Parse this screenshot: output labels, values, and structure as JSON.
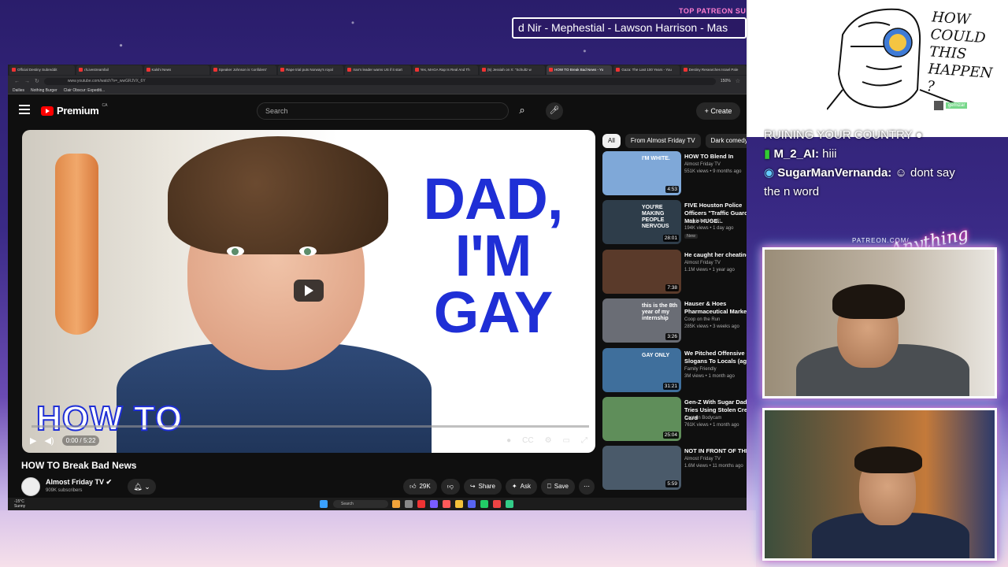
{
  "overlay": {
    "patreon_label": "TOP PATREON SUBS",
    "ticker_text": "d Nir - Mephestial - Lawson Harrison - Mas",
    "drawing_text": "HOW COULD THIS HAPPEN ?",
    "drawing_user": "gemizar",
    "patreon_url": "PATREON.COM/",
    "anything_else": "Anything Else",
    "chat": [
      {
        "user": "",
        "text": "RUINING YOUR COUNTRY"
      },
      {
        "user": "M_2_AI:",
        "text": "hiii"
      },
      {
        "user": "SugarManVernanda:",
        "text": "dont say"
      },
      {
        "user": "",
        "text": "the n word"
      }
    ]
  },
  "browser": {
    "tabs": [
      {
        "label": "Official Destiny Subreddit"
      },
      {
        "label": "r/Livestreamfail"
      },
      {
        "label": "Kalshi News"
      },
      {
        "label": "Speaker Johnson is 'confident'"
      },
      {
        "label": "Rape trial puts Norway's royal"
      },
      {
        "label": "Iran's leader warns US if it start"
      },
      {
        "label": "Yes, MAGA Rap Is Real And Th"
      },
      {
        "label": "(5) Jessiah on X: \"Schultz w"
      },
      {
        "label": "HOW TO Break Bad News - Yo"
      },
      {
        "label": "Gaza: The Last 100 Years - You"
      },
      {
        "label": "Destiny Researches Israel Pale"
      }
    ],
    "url": "www.youtube.com/watch?v=_wwGRJVX_6Y",
    "zoom": "150%",
    "bookmarks": [
      "Dailies",
      "Nothing Burger",
      "Clair Obscur: Expediti..."
    ]
  },
  "youtube": {
    "logo_text": "Premium",
    "logo_region": "CA",
    "search_placeholder": "Search",
    "create_label": "Create",
    "thumbnail_title": "DAD, I'M GAY",
    "thumbnail_overlay": "HOW TO",
    "time": "0:00 / 5:22",
    "video_title": "HOW TO Break Bad News",
    "channel_name": "Almost Friday TV",
    "channel_subs": "909K subscribers",
    "likes": "29K",
    "share_label": "Share",
    "ask_label": "Ask",
    "save_label": "Save",
    "chips": [
      "All",
      "From Almost Friday TV",
      "Dark comedy"
    ],
    "recommendations": [
      {
        "title": "HOW TO Blend In",
        "channel": "Almost Friday TV",
        "meta": "551K views • 9 months ago",
        "duration": "4:53",
        "thumb_color": "#7fa8d8",
        "thumb_text": "I'M WHITE.",
        "new": ""
      },
      {
        "title": "FIVE Houston Police Officers \"Traffic Guard\" Make HUGE...",
        "channel": "Long Island Audit",
        "meta": "194K views • 1 day ago",
        "duration": "28:01",
        "thumb_color": "#2e3d4a",
        "thumb_text": "YOU'RE MAKING PEOPLE NERVOUS",
        "new": "New"
      },
      {
        "title": "He caught her cheating...",
        "channel": "Almost Friday TV",
        "meta": "1.1M views • 1 year ago",
        "duration": "7:38",
        "thumb_color": "#5a3a2a",
        "thumb_text": "",
        "new": ""
      },
      {
        "title": "Hauser & Hoes Pharmaceutical Marketing",
        "channel": "Coop on the Run",
        "meta": "285K views • 3 weeks ago",
        "duration": "3:26",
        "thumb_color": "#6a6d75",
        "thumb_text": "this is the 8th year of my internship",
        "new": ""
      },
      {
        "title": "We Pitched Offensive City Slogans To Locals (again)",
        "channel": "Family Friendly",
        "meta": "3M views • 1 month ago",
        "duration": "31:21",
        "thumb_color": "#3f6f9c",
        "thumb_text": "GAY ONLY",
        "new": ""
      },
      {
        "title": "Gen-Z With Sugar Daddy Tries Using Stolen Credit Card",
        "channel": "Captain Bodycam",
        "meta": "761K views • 1 month ago",
        "duration": "25:04",
        "thumb_color": "#5f8e5a",
        "thumb_text": "",
        "new": ""
      },
      {
        "title": "NOT IN FRONT OF THE IN...",
        "channel": "Almost Friday TV",
        "meta": "1.6M views • 11 months ago",
        "duration": "5:59",
        "thumb_color": "#4a5a6a",
        "thumb_text": "",
        "new": ""
      }
    ]
  },
  "taskbar": {
    "weather_temp": "-15°C",
    "weather_text": "Sunny",
    "search_label": "Search"
  }
}
